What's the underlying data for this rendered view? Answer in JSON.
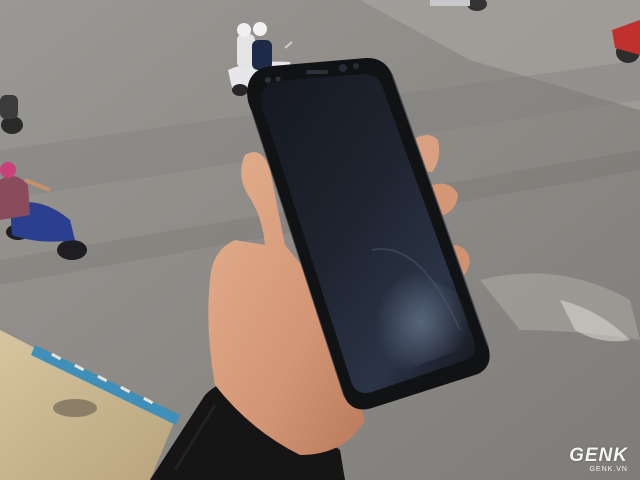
{
  "image": {
    "subject": "hand-holding-black-smartphone-over-street",
    "colors": {
      "road": "#8f8c88",
      "phone_body": "#111214",
      "screen": "#1b1e26",
      "skin": "#d59a78",
      "sleeve": "#151515",
      "ledge": "#c9b58f",
      "tile_blue": "#3f8fb8"
    }
  },
  "watermark": {
    "logo": "GENK",
    "domain": "GENK.VN"
  }
}
